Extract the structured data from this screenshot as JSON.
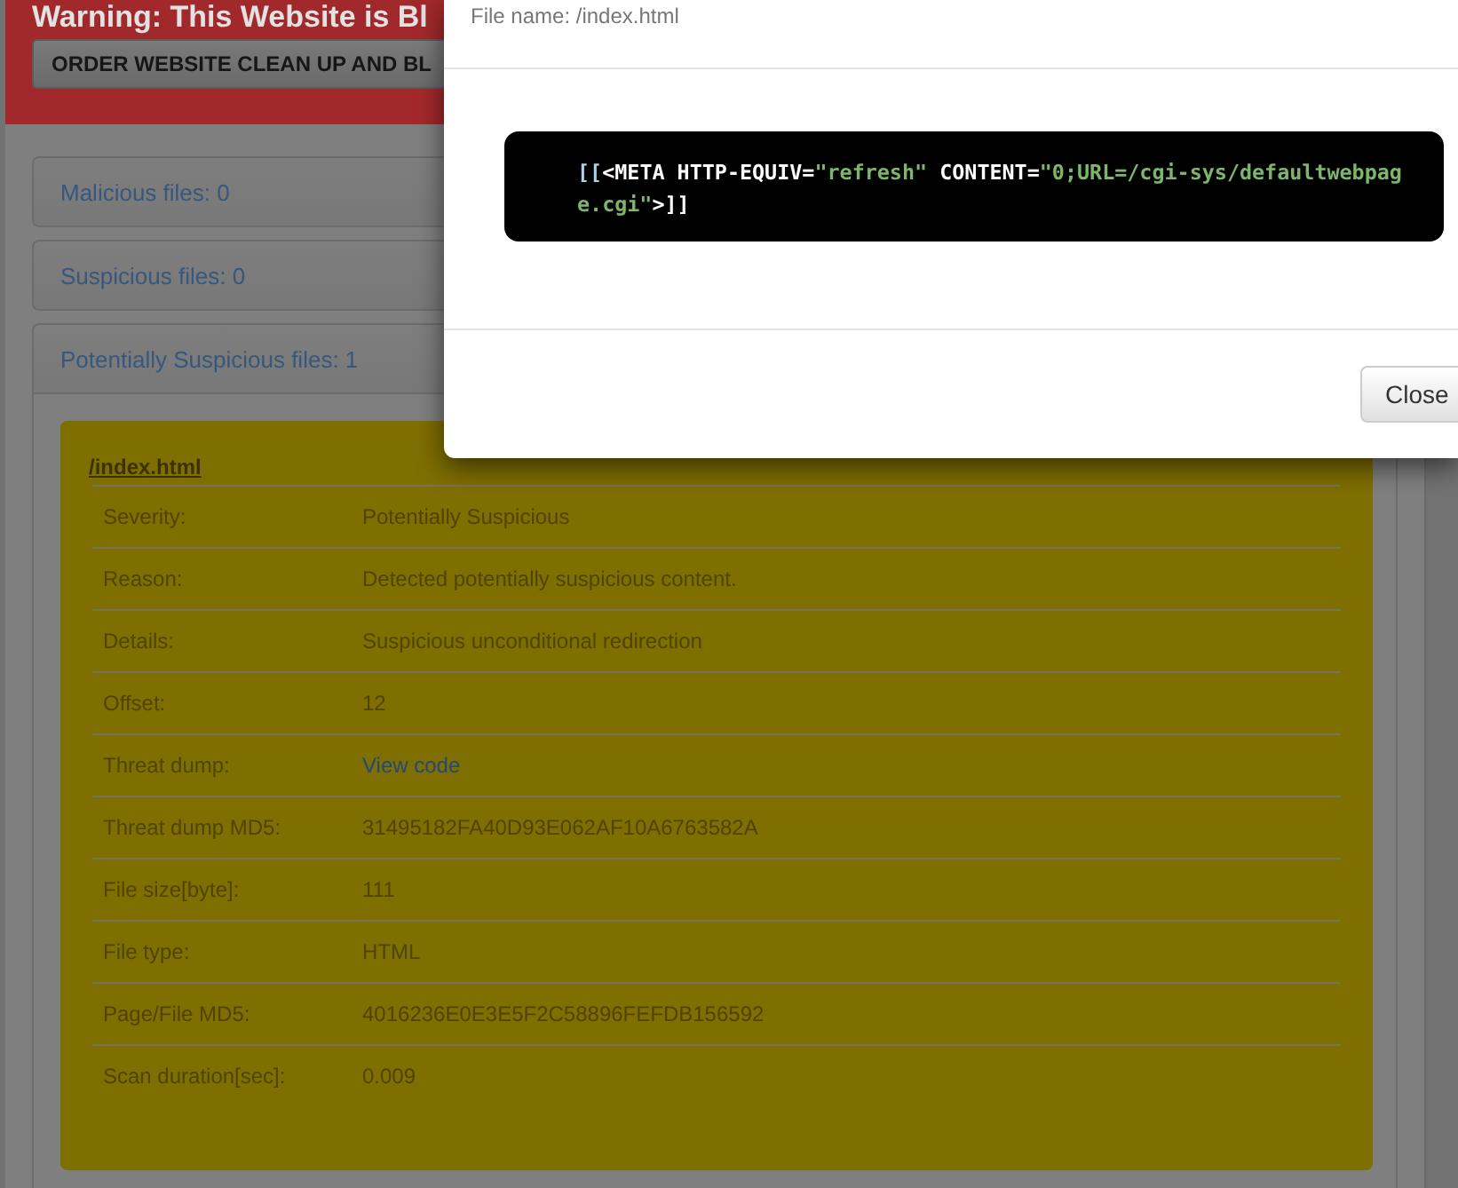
{
  "banner": {
    "title": "Warning: This Website is Bl",
    "button": "ORDER WEBSITE CLEAN UP AND BL"
  },
  "accordion": [
    {
      "title": "Malicious files: 0",
      "expanded": false
    },
    {
      "title": "Suspicious files: 0",
      "expanded": false
    },
    {
      "title": "Potentially Suspicious files: 1",
      "expanded": true,
      "files": [
        {
          "name": "/index.html",
          "details": [
            {
              "label": "Severity:",
              "value": "Potentially Suspicious",
              "kind": "text"
            },
            {
              "label": "Reason:",
              "value": "Detected potentially suspicious content.",
              "kind": "text"
            },
            {
              "label": "Details:",
              "value": "Suspicious unconditional redirection",
              "kind": "text"
            },
            {
              "label": "Offset:",
              "value": "12",
              "kind": "text"
            },
            {
              "label": "Threat dump:",
              "value": "View code",
              "kind": "link"
            },
            {
              "label": "Threat dump MD5:",
              "value": "31495182FA40D93E062AF10A6763582A",
              "kind": "text"
            },
            {
              "label": "File size[byte]:",
              "value": "111",
              "kind": "text"
            },
            {
              "label": "File type:",
              "value": "HTML",
              "kind": "text"
            },
            {
              "label": "Page/File MD5:",
              "value": "4016236E0E3E5F2C58896FEFDB156592",
              "kind": "text"
            },
            {
              "label": "Scan duration[sec]:",
              "value": "0.009",
              "kind": "text"
            }
          ]
        }
      ]
    }
  ],
  "modal": {
    "title": "File name: /index.html",
    "code_lines": [
      [
        {
          "kind": "bracket",
          "text": "[["
        },
        {
          "kind": "tag",
          "text": "<META HTTP-EQUIV="
        },
        {
          "kind": "string",
          "text": "\"refresh\""
        },
        {
          "kind": "tag",
          "text": " CONTENT="
        },
        {
          "kind": "string",
          "text": "\"0;URL=/cgi-sys/defaultwebpag"
        }
      ],
      [
        {
          "kind": "string",
          "text": "e.cgi\""
        },
        {
          "kind": "tag",
          "text": ">]]"
        }
      ]
    ],
    "buttons": [
      "Close"
    ]
  }
}
